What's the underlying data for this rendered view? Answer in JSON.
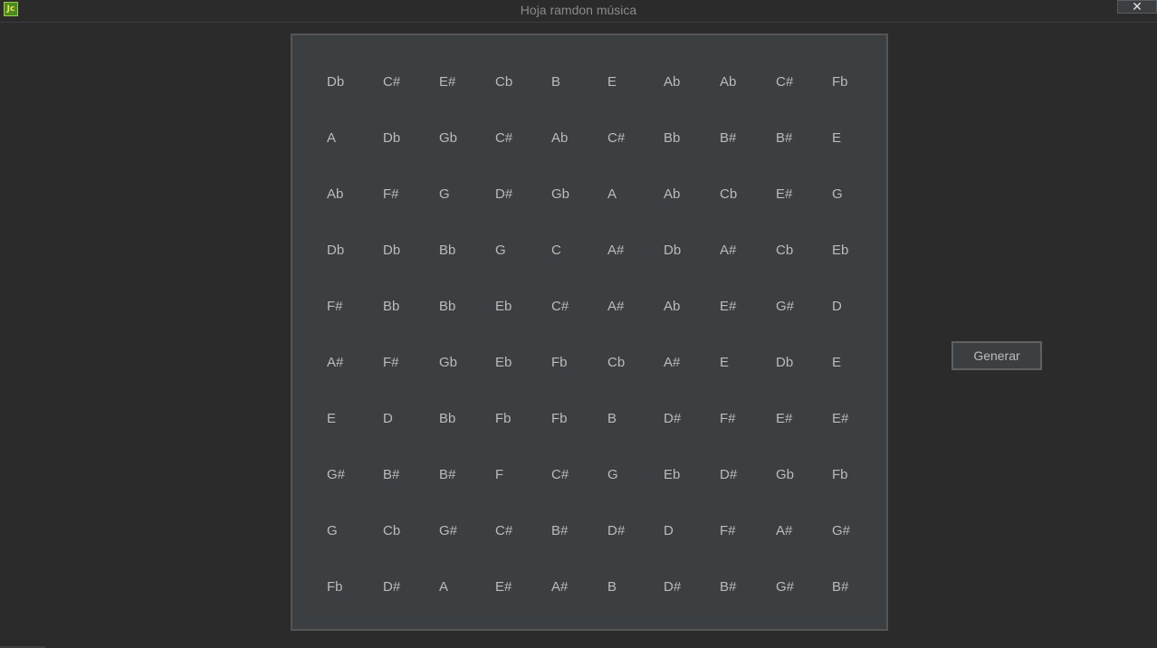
{
  "window": {
    "title": "Hoja ramdon música",
    "app_icon_text": "Jc",
    "close_symbol": "✕"
  },
  "colors": {
    "background": "#2b2b2b",
    "panel": "#3c3f41",
    "text": "#bbbbbb"
  },
  "grid": [
    [
      "Db",
      "C#",
      "E#",
      "Cb",
      "B",
      "E",
      "Ab",
      "Ab",
      "C#",
      "Fb"
    ],
    [
      "A",
      "Db",
      "Gb",
      "C#",
      "Ab",
      "C#",
      "Bb",
      "B#",
      "B#",
      "E"
    ],
    [
      "Ab",
      "F#",
      "G",
      "D#",
      "Gb",
      "A",
      "Ab",
      "Cb",
      "E#",
      "G"
    ],
    [
      "Db",
      "Db",
      "Bb",
      "G",
      "C",
      "A#",
      "Db",
      "A#",
      "Cb",
      "Eb"
    ],
    [
      "F#",
      "Bb",
      "Bb",
      "Eb",
      "C#",
      "A#",
      "Ab",
      "E#",
      "G#",
      "D"
    ],
    [
      "A#",
      "F#",
      "Gb",
      "Eb",
      "Fb",
      "Cb",
      "A#",
      "E",
      "Db",
      "E"
    ],
    [
      "E",
      "D",
      "Bb",
      "Fb",
      "Fb",
      "B",
      "D#",
      "F#",
      "E#",
      "E#"
    ],
    [
      "G#",
      "B#",
      "B#",
      "F",
      "C#",
      "G",
      "Eb",
      "D#",
      "Gb",
      "Fb"
    ],
    [
      "G",
      "Cb",
      "G#",
      "C#",
      "B#",
      "D#",
      "D",
      "F#",
      "A#",
      "G#"
    ],
    [
      "Fb",
      "D#",
      "A",
      "E#",
      "A#",
      "B",
      "D#",
      "B#",
      "G#",
      "B#"
    ]
  ],
  "generate_button": {
    "label": "Generar"
  }
}
